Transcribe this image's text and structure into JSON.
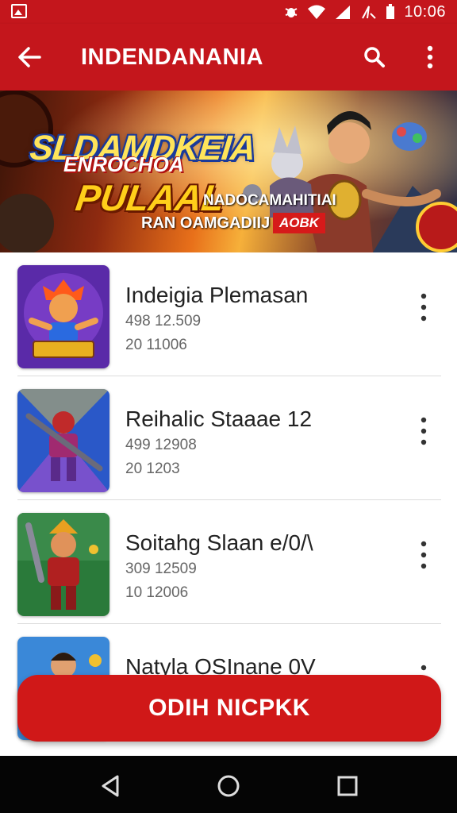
{
  "status_bar": {
    "time": "10:06",
    "icons": [
      "gallery-icon",
      "bug-icon",
      "wifi-icon",
      "signal-icon",
      "battery-icon"
    ]
  },
  "app_bar": {
    "title": "INDENDANANIA",
    "back_icon": "arrow-left-icon",
    "search_icon": "search-icon",
    "more_icon": "more-vert-icon"
  },
  "banner": {
    "title_line1": "SLDAMDKEIA",
    "title_line2": "ENROCHOA",
    "title_big": "PULAAL",
    "tagline": "NADOCAMAHITIAI",
    "line": "RAN OAMGADIIJ",
    "badge": "AOBK"
  },
  "items": [
    {
      "name": "Indeigia Plemasan",
      "meta1": "498 12.509",
      "meta2": "20 11006"
    },
    {
      "name": "Reihalic Staaae 12",
      "meta1": "499 12908",
      "meta2": "20 1203"
    },
    {
      "name": "Soitahg Slaan e/0/\\",
      "meta1": "309 12509",
      "meta2": "10 12006"
    },
    {
      "name": "Natyla OSInane 0V",
      "meta1": "",
      "meta2": ""
    }
  ],
  "cta": {
    "label": "ODIH NICPKK"
  },
  "colors": {
    "primary": "#c4161c",
    "cta": "#d01818",
    "nav_bar": "#050505"
  }
}
